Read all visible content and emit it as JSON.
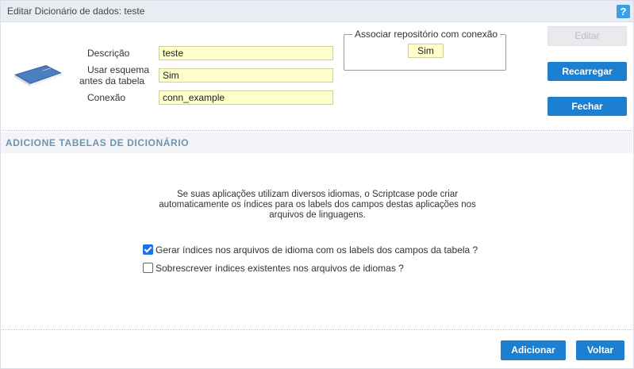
{
  "window": {
    "title": "Editar Dicionário de dados: teste",
    "help_label": "?"
  },
  "form": {
    "descricao_label": "Descrição",
    "descricao_value": "teste",
    "usar_esquema_label_line1": "Usar esquema",
    "usar_esquema_label_line2": "antes da tabela",
    "usar_esquema_value": "Sim",
    "conexao_label": "Conexão",
    "conexao_value": "conn_example",
    "fieldset_legend": "Associar repositório com conexão",
    "fieldset_value": "Sim"
  },
  "buttons": {
    "editar": "Editar",
    "recarregar": "Recarregar",
    "fechar": "Fechar",
    "adicionar": "Adicionar",
    "voltar": "Voltar"
  },
  "section": {
    "title": "ADICIONE TABELAS DE DICIONÁRIO",
    "info_line1": "Se suas aplicações utilizam diversos idiomas, o Scriptcase pode criar",
    "info_line2": "automaticamente os índices para os labels dos campos destas aplicações nos",
    "info_line3": "arquivos de linguagens.",
    "option1_label": "Gerar índices nos arquivos de idioma com os labels dos campos da tabela ?",
    "option1_checked": true,
    "option2_label": "Sobrescrever índices existentes nos arquivos de idiomas ?",
    "option2_checked": false
  },
  "colors": {
    "accent": "#1c7fd0",
    "help": "#3aa0e6",
    "field_bg": "#ffffcc",
    "section_title": "#6f93ad"
  }
}
